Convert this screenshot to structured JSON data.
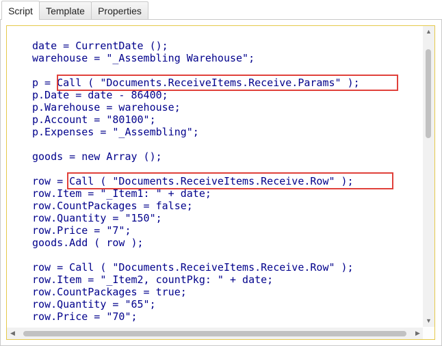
{
  "tabs": [
    {
      "label": "Script",
      "active": true
    },
    {
      "label": "Template",
      "active": false
    },
    {
      "label": "Properties",
      "active": false
    }
  ],
  "editor": {
    "lines": [
      "date = CurrentDate ();",
      "warehouse = \"_Assembling Warehouse\";",
      "",
      "p = Call ( \"Documents.ReceiveItems.Receive.Params\" );",
      "p.Date = date - 86400;",
      "p.Warehouse = warehouse;",
      "p.Account = \"80100\";",
      "p.Expenses = \"_Assembling\";",
      "",
      "goods = new Array ();",
      "",
      "row = Call ( \"Documents.ReceiveItems.Receive.Row\" );",
      "row.Item = \"_Item1: \" + date;",
      "row.CountPackages = false;",
      "row.Quantity = \"150\";",
      "row.Price = \"7\";",
      "goods.Add ( row );",
      "",
      "row = Call ( \"Documents.ReceiveItems.Receive.Row\" );",
      "row.Item = \"_Item2, countPkg: \" + date;",
      "row.CountPackages = true;",
      "row.Quantity = \"65\";",
      "row.Price = \"70\";"
    ]
  },
  "icons": {
    "scroll_up": "scroll-up-arrow-icon",
    "scroll_down": "scroll-down-arrow-icon",
    "scroll_left": "scroll-left-arrow-icon",
    "scroll_right": "scroll-right-arrow-icon"
  },
  "colors": {
    "code_text": "#00008b",
    "highlight_border": "#e0403a",
    "editor_border": "#e5c94a"
  }
}
